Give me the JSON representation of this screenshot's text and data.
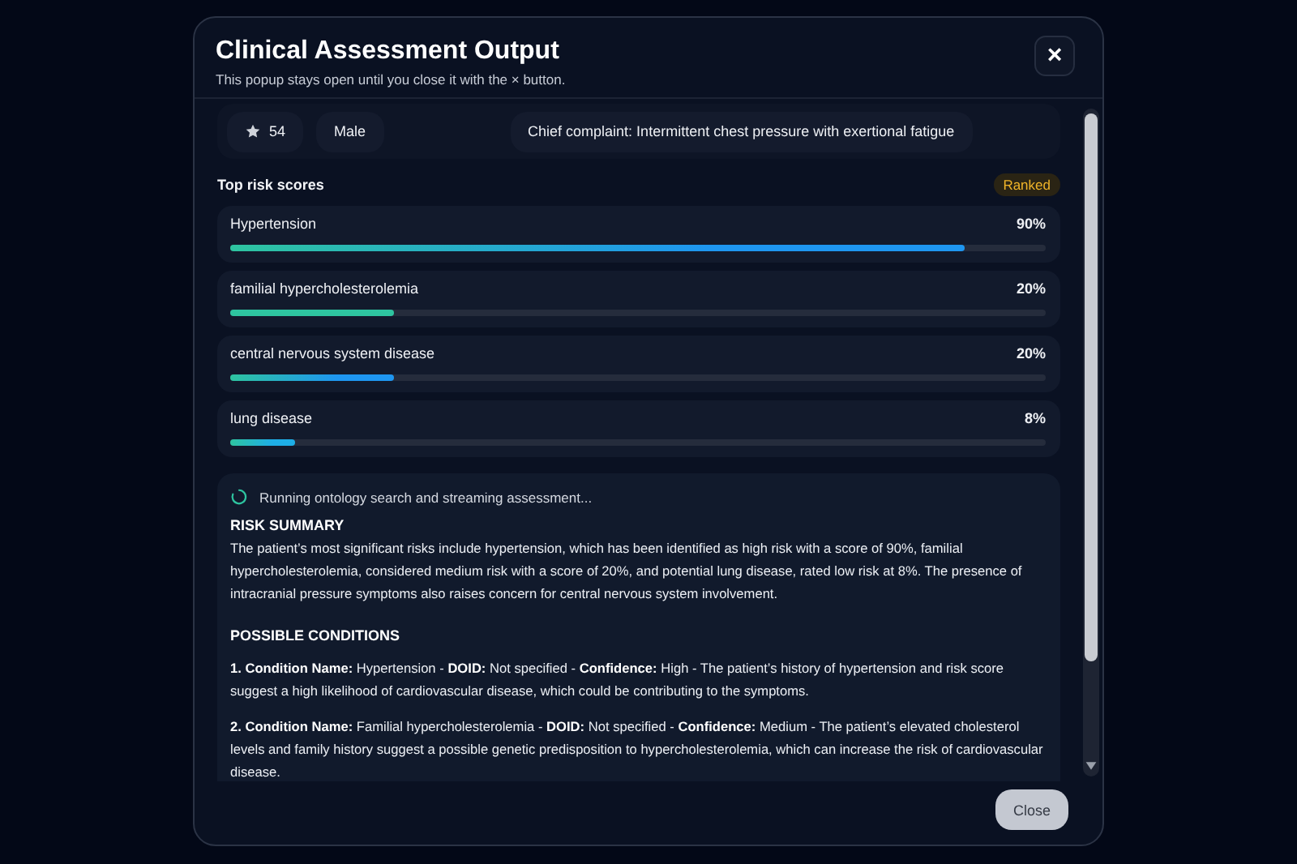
{
  "dialog": {
    "title": "Clinical Assessment Output",
    "subtitle": "This popup stays open until you close it with the × button.",
    "close_icon": "×"
  },
  "patient": {
    "age": "54",
    "sex": "Male",
    "complaint": "Chief complaint: Intermittent chest pressure with exertional fatigue"
  },
  "risk_section": {
    "title": "Top risk scores",
    "badge": "Ranked"
  },
  "risks": [
    {
      "name": "Hypertension",
      "reading": "90%",
      "level": 0.9,
      "color": "#1e96f0"
    },
    {
      "name": "familial hypercholesterolemia",
      "reading": "20%",
      "level": 0.2,
      "color": "#2ec4a0"
    },
    {
      "name": "central nervous system disease",
      "reading": "20%",
      "level": 0.2,
      "color": "#1e96f0"
    },
    {
      "name": "lung disease",
      "reading": "8%",
      "level": 0.08,
      "color": "#1eaee6"
    }
  ],
  "assessment": {
    "status": "Running ontology search and streaming assessment...",
    "blocks": [
      {
        "kind": "heading",
        "text": "RISK SUMMARY"
      },
      {
        "kind": "paragraph",
        "text": "The patient’s most significant risks include hypertension, which has been identified as high risk with a score of 90%, familial hypercholesterolemia, considered medium risk with a score of 20%, and potential lung disease, rated low risk at 8%. The presence of intracranial pressure symptoms also raises concern for central nervous system involvement."
      },
      {
        "kind": "heading",
        "text": "POSSIBLE CONDITIONS"
      },
      {
        "kind": "paragraph",
        "text": "**1. Condition Name:** Hypertension - **DOID:** Not specified - **Confidence:** High - The patient’s history of hypertension and risk score suggest a high likelihood of cardiovascular disease, which could be contributing to the symptoms."
      },
      {
        "kind": "paragraph",
        "text": "**2. Condition Name:** Familial hypercholesterolemia - **DOID:** Not specified - **Confidence:** Medium - The patient’s elevated cholesterol levels and family history suggest a possible genetic predisposition to hypercholesterolemia, which can increase the risk of cardiovascular disease."
      }
    ]
  },
  "buttons": [
    "Close"
  ]
}
